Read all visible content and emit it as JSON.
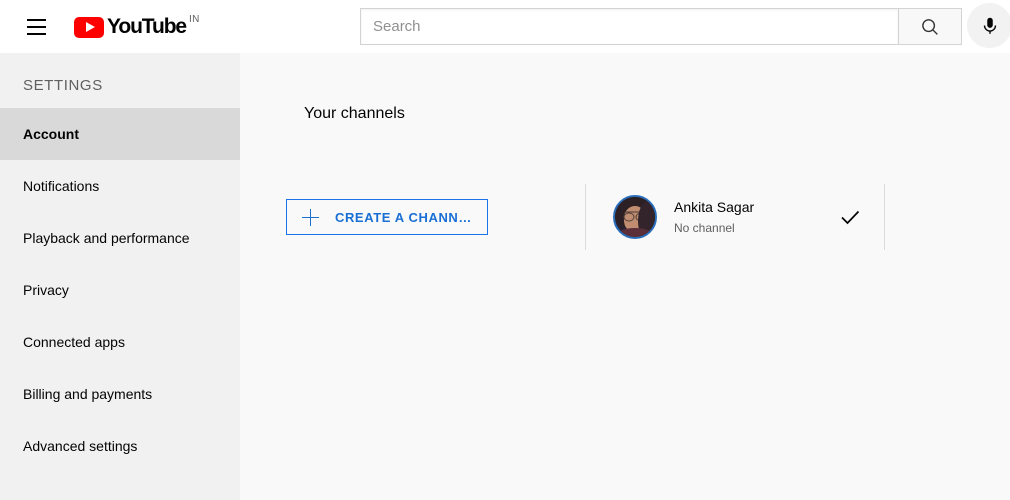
{
  "header": {
    "menu_icon": "hamburger-menu-icon",
    "logo_text": "YouTube",
    "logo_country": "IN",
    "search": {
      "placeholder": "Search",
      "value": "",
      "button_icon": "search-icon"
    },
    "mic_icon": "microphone-icon"
  },
  "sidebar": {
    "title": "SETTINGS",
    "items": [
      {
        "label": "Account",
        "active": true
      },
      {
        "label": "Notifications",
        "active": false
      },
      {
        "label": "Playback and performance",
        "active": false
      },
      {
        "label": "Privacy",
        "active": false
      },
      {
        "label": "Connected apps",
        "active": false
      },
      {
        "label": "Billing and payments",
        "active": false
      },
      {
        "label": "Advanced settings",
        "active": false
      }
    ]
  },
  "main": {
    "section_title": "Your channels",
    "create_channel_button": {
      "label": "CREATE A CHANN…",
      "icon": "plus-icon"
    },
    "account": {
      "name": "Ankita Sagar",
      "subtitle": "No channel",
      "avatar_icon": "user-avatar-photo",
      "selected_icon": "check-icon"
    }
  },
  "colors": {
    "brand_red": "#ff0000",
    "accent_blue": "#1a6fd4",
    "sidebar_bg": "#f1f1f1",
    "sidebar_active_bg": "#d9d9d9",
    "main_bg": "#f9f9f9",
    "header_bg": "#ffffff",
    "text_primary": "#030303",
    "text_secondary": "#606060"
  }
}
